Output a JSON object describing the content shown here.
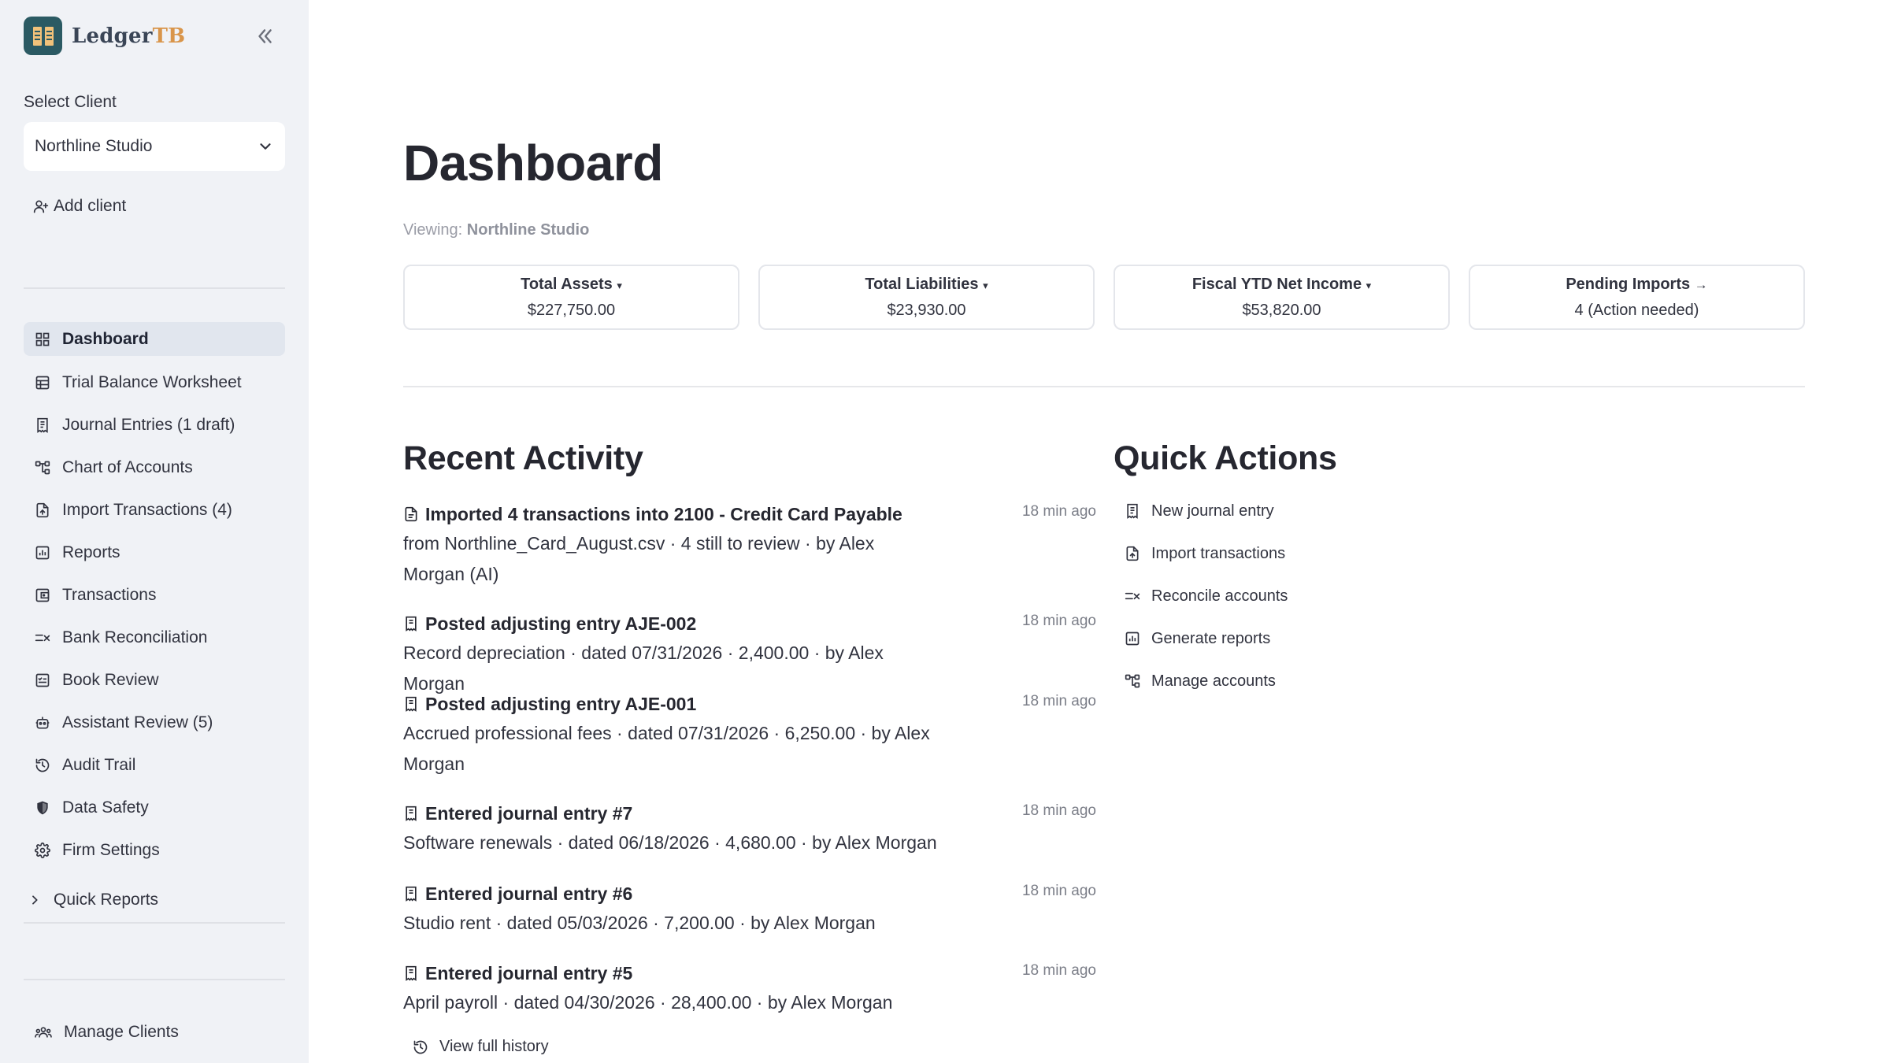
{
  "brand": {
    "name_main": "Ledger",
    "name_accent": "TB"
  },
  "sidebar": {
    "select_label": "Select Client",
    "selected_client": "Northline Studio",
    "add_client": "Add client",
    "nav": [
      {
        "label": "Dashboard",
        "icon": "grid-icon",
        "active": true
      },
      {
        "label": "Trial Balance Worksheet",
        "icon": "table-icon"
      },
      {
        "label": "Journal Entries (1 draft)",
        "icon": "receipt-icon"
      },
      {
        "label": "Chart of Accounts",
        "icon": "hierarchy-icon"
      },
      {
        "label": "Import Transactions (4)",
        "icon": "file-upload-icon"
      },
      {
        "label": "Reports",
        "icon": "report-chart-icon"
      },
      {
        "label": "Transactions",
        "icon": "transactions-icon"
      },
      {
        "label": "Bank Reconciliation",
        "icon": "reconcile-icon"
      },
      {
        "label": "Book Review",
        "icon": "review-icon"
      },
      {
        "label": "Assistant Review (5)",
        "icon": "robot-icon"
      },
      {
        "label": "Audit Trail",
        "icon": "history-icon"
      },
      {
        "label": "Data Safety",
        "icon": "shield-icon"
      },
      {
        "label": "Firm Settings",
        "icon": "gear-icon"
      }
    ],
    "quick_reports": "Quick Reports",
    "manage_clients": "Manage Clients"
  },
  "main": {
    "title": "Dashboard",
    "viewing_prefix": "Viewing:",
    "viewing_client": "Northline Studio",
    "metrics": [
      {
        "label": "Total Assets",
        "indicator": "▾",
        "value": "$227,750.00"
      },
      {
        "label": "Total Liabilities",
        "indicator": "▾",
        "value": "$23,930.00"
      },
      {
        "label": "Fiscal YTD Net Income",
        "indicator": "▾",
        "value": "$53,820.00"
      },
      {
        "label": "Pending Imports",
        "indicator": "→",
        "value": "4 (Action needed)"
      }
    ],
    "recent_activity_title": "Recent Activity",
    "activity": [
      {
        "icon": "file-icon",
        "title": "Imported 4 transactions into 2100 - Credit Card Payable",
        "desc": "from Northline_Card_August.csv · 4 still to review · by Alex Morgan (AI)",
        "time": "18 min ago"
      },
      {
        "icon": "receipt-icon",
        "title": "Posted adjusting entry AJE-002",
        "desc": "Record depreciation · dated 07/31/2026 · 2,400.00 · by Alex Morgan",
        "time": "18 min ago"
      },
      {
        "icon": "receipt-icon",
        "title": "Posted adjusting entry AJE-001",
        "desc": "Accrued professional fees · dated 07/31/2026 · 6,250.00 · by Alex Morgan",
        "time": "18 min ago"
      },
      {
        "icon": "receipt-icon",
        "title": "Entered journal entry #7",
        "desc": "Software renewals · dated 06/18/2026 · 4,680.00 · by Alex Morgan",
        "time": "18 min ago"
      },
      {
        "icon": "receipt-icon",
        "title": "Entered journal entry #6",
        "desc": "Studio rent · dated 05/03/2026 · 7,200.00 · by Alex Morgan",
        "time": "18 min ago"
      },
      {
        "icon": "receipt-icon",
        "title": "Entered journal entry #5",
        "desc": "April payroll · dated 04/30/2026 · 28,400.00 · by Alex Morgan",
        "time": "18 min ago"
      }
    ],
    "view_history": "View full history",
    "quick_actions_title": "Quick Actions",
    "quick_actions": [
      {
        "label": "New journal entry",
        "icon": "receipt-icon"
      },
      {
        "label": "Import transactions",
        "icon": "file-upload-icon"
      },
      {
        "label": "Reconcile accounts",
        "icon": "reconcile-icon"
      },
      {
        "label": "Generate reports",
        "icon": "report-chart-icon"
      },
      {
        "label": "Manage accounts",
        "icon": "hierarchy-icon"
      }
    ]
  }
}
